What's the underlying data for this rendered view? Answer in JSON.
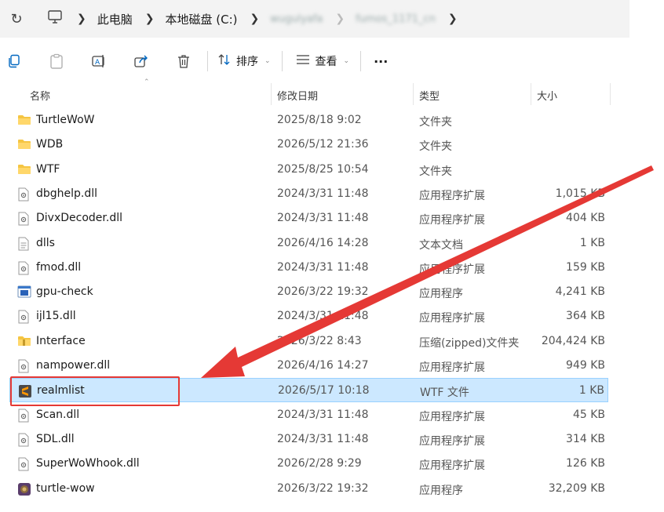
{
  "address": {
    "crumbs": [
      "此电脑",
      "本地磁盘 (C:)",
      "wugulyafa",
      "fumos_1171_cn"
    ]
  },
  "toolbar": {
    "sort_label": "排序",
    "view_label": "查看",
    "more_label": "···"
  },
  "columns": {
    "name": "名称",
    "date": "修改日期",
    "type": "类型",
    "size": "大小"
  },
  "files": [
    {
      "name": "TurtleWoW",
      "date": "2025/8/18 9:02",
      "type": "文件夹",
      "size": "",
      "icon": "folder-icon"
    },
    {
      "name": "WDB",
      "date": "2026/5/12 21:36",
      "type": "文件夹",
      "size": "",
      "icon": "folder-icon"
    },
    {
      "name": "WTF",
      "date": "2025/8/25 10:54",
      "type": "文件夹",
      "size": "",
      "icon": "folder-icon"
    },
    {
      "name": "dbghelp.dll",
      "date": "2024/3/31 11:48",
      "type": "应用程序扩展",
      "size": "1,015 KB",
      "icon": "dll-icon"
    },
    {
      "name": "DivxDecoder.dll",
      "date": "2024/3/31 11:48",
      "type": "应用程序扩展",
      "size": "404 KB",
      "icon": "dll-icon"
    },
    {
      "name": "dlls",
      "date": "2026/4/16 14:28",
      "type": "文本文档",
      "size": "1 KB",
      "icon": "text-file-icon"
    },
    {
      "name": "fmod.dll",
      "date": "2024/3/31 11:48",
      "type": "应用程序扩展",
      "size": "159 KB",
      "icon": "dll-icon"
    },
    {
      "name": "gpu-check",
      "date": "2026/3/22 19:32",
      "type": "应用程序",
      "size": "4,241 KB",
      "icon": "app-icon"
    },
    {
      "name": "ijl15.dll",
      "date": "2024/3/31 11:48",
      "type": "应用程序扩展",
      "size": "364 KB",
      "icon": "dll-icon"
    },
    {
      "name": "Interface",
      "date": "2026/3/22 8:43",
      "type": "压缩(zipped)文件夹",
      "size": "204,424 KB",
      "icon": "zip-folder-icon"
    },
    {
      "name": "nampower.dll",
      "date": "2026/4/16 14:27",
      "type": "应用程序扩展",
      "size": "949 KB",
      "icon": "dll-icon"
    },
    {
      "name": "realmlist",
      "date": "2026/5/17 10:18",
      "type": "WTF 文件",
      "size": "1 KB",
      "icon": "sublime-file-icon",
      "selected": true
    },
    {
      "name": "Scan.dll",
      "date": "2024/3/31 11:48",
      "type": "应用程序扩展",
      "size": "45 KB",
      "icon": "dll-icon"
    },
    {
      "name": "SDL.dll",
      "date": "2024/3/31 11:48",
      "type": "应用程序扩展",
      "size": "314 KB",
      "icon": "dll-icon"
    },
    {
      "name": "SuperWoWhook.dll",
      "date": "2026/2/28 9:29",
      "type": "应用程序扩展",
      "size": "126 KB",
      "icon": "dll-icon"
    },
    {
      "name": "turtle-wow",
      "date": "2026/3/22 19:32",
      "type": "应用程序",
      "size": "32,209 KB",
      "icon": "turtle-wow-app-icon"
    }
  ],
  "colors": {
    "folder": "#f5c542",
    "selection": "#cce8ff",
    "annotation": "#e53935"
  }
}
